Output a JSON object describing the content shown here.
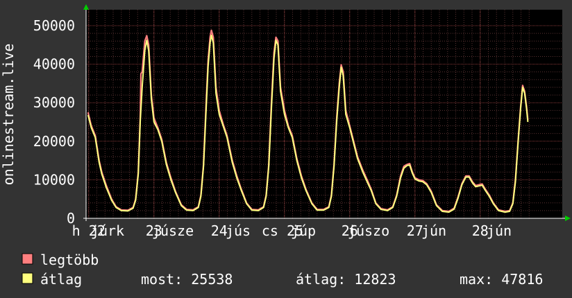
{
  "chart_data": {
    "type": "line",
    "ylabel": "onlinestream.live",
    "ylim": [
      0,
      50000
    ],
    "yticks": [
      "0",
      "10000",
      "20000",
      "30000",
      "40000",
      "50000"
    ],
    "grid": true,
    "xticks": [
      {
        "label": "h 22",
        "day": 0.0
      },
      {
        "label": "júrk",
        "day": 0.29
      },
      {
        "label": "23",
        "day": 1.0
      },
      {
        "label": "júsze",
        "day": 1.29
      },
      {
        "label": "24",
        "day": 2.0
      },
      {
        "label": "jús",
        "day": 2.29
      },
      {
        "label": "cs 25",
        "day": 2.97
      },
      {
        "label": "júp",
        "day": 3.29
      },
      {
        "label": "26",
        "day": 4.0
      },
      {
        "label": "júszo",
        "day": 4.29
      },
      {
        "label": "27",
        "day": 5.0
      },
      {
        "label": "jún",
        "day": 5.29
      },
      {
        "label": "28",
        "day": 6.0
      },
      {
        "label": "jún",
        "day": 6.29
      }
    ],
    "x_range": [
      -0.04,
      6.86
    ],
    "series": [
      {
        "name": "legtöbb",
        "color": "#ff7f7f",
        "points": [
          [
            -0.01,
            27500
          ],
          [
            0.04,
            24000
          ],
          [
            0.1,
            21500
          ],
          [
            0.16,
            15000
          ],
          [
            0.2,
            12000
          ],
          [
            0.27,
            8500
          ],
          [
            0.35,
            5000
          ],
          [
            0.42,
            3000
          ],
          [
            0.5,
            2200
          ],
          [
            0.6,
            2100
          ],
          [
            0.68,
            2800
          ],
          [
            0.72,
            5000
          ],
          [
            0.76,
            12000
          ],
          [
            0.79,
            26000
          ],
          [
            0.8,
            37500
          ],
          [
            0.82,
            38000
          ],
          [
            0.86,
            46000
          ],
          [
            0.89,
            47400
          ],
          [
            0.92,
            45000
          ],
          [
            0.96,
            32000
          ],
          [
            1.0,
            26000
          ],
          [
            1.06,
            23500
          ],
          [
            1.12,
            20500
          ],
          [
            1.19,
            14500
          ],
          [
            1.26,
            10500
          ],
          [
            1.33,
            7000
          ],
          [
            1.42,
            3500
          ],
          [
            1.5,
            2300
          ],
          [
            1.6,
            2200
          ],
          [
            1.68,
            3000
          ],
          [
            1.72,
            6000
          ],
          [
            1.76,
            14000
          ],
          [
            1.8,
            30000
          ],
          [
            1.83,
            41000
          ],
          [
            1.86,
            47000
          ],
          [
            1.88,
            48800
          ],
          [
            1.91,
            47000
          ],
          [
            1.95,
            34000
          ],
          [
            2.0,
            28000
          ],
          [
            2.06,
            24500
          ],
          [
            2.12,
            21500
          ],
          [
            2.2,
            15000
          ],
          [
            2.27,
            11000
          ],
          [
            2.34,
            7500
          ],
          [
            2.42,
            4000
          ],
          [
            2.5,
            2300
          ],
          [
            2.6,
            2200
          ],
          [
            2.68,
            3000
          ],
          [
            2.72,
            6000
          ],
          [
            2.76,
            14000
          ],
          [
            2.8,
            30000
          ],
          [
            2.84,
            43000
          ],
          [
            2.87,
            47000
          ],
          [
            2.9,
            46000
          ],
          [
            2.94,
            34000
          ],
          [
            3.0,
            28000
          ],
          [
            3.06,
            24000
          ],
          [
            3.12,
            21500
          ],
          [
            3.19,
            15500
          ],
          [
            3.26,
            11000
          ],
          [
            3.33,
            7500
          ],
          [
            3.42,
            4000
          ],
          [
            3.5,
            2300
          ],
          [
            3.6,
            2300
          ],
          [
            3.68,
            3000
          ],
          [
            3.72,
            6000
          ],
          [
            3.76,
            14000
          ],
          [
            3.8,
            26000
          ],
          [
            3.84,
            35000
          ],
          [
            3.87,
            39800
          ],
          [
            3.9,
            38000
          ],
          [
            3.94,
            28000
          ],
          [
            4.0,
            24000
          ],
          [
            4.06,
            20000
          ],
          [
            4.12,
            16000
          ],
          [
            4.2,
            12500
          ],
          [
            4.28,
            9500
          ],
          [
            4.33,
            7500
          ],
          [
            4.4,
            4000
          ],
          [
            4.48,
            2500
          ],
          [
            4.58,
            2200
          ],
          [
            4.66,
            3000
          ],
          [
            4.72,
            6000
          ],
          [
            4.78,
            11000
          ],
          [
            4.83,
            13500
          ],
          [
            4.88,
            14000
          ],
          [
            4.92,
            14200
          ],
          [
            4.96,
            12000
          ],
          [
            5.0,
            10500
          ],
          [
            5.06,
            10000
          ],
          [
            5.12,
            9800
          ],
          [
            5.18,
            9000
          ],
          [
            5.25,
            7000
          ],
          [
            5.33,
            3500
          ],
          [
            5.42,
            2000
          ],
          [
            5.52,
            1800
          ],
          [
            5.6,
            2600
          ],
          [
            5.66,
            5500
          ],
          [
            5.72,
            9000
          ],
          [
            5.78,
            11000
          ],
          [
            5.83,
            11000
          ],
          [
            5.88,
            9500
          ],
          [
            5.93,
            8500
          ],
          [
            5.98,
            8700
          ],
          [
            6.03,
            8900
          ],
          [
            6.08,
            7500
          ],
          [
            6.14,
            6000
          ],
          [
            6.2,
            4000
          ],
          [
            6.28,
            2200
          ],
          [
            6.38,
            1800
          ],
          [
            6.45,
            2000
          ],
          [
            6.5,
            4000
          ],
          [
            6.54,
            10000
          ],
          [
            6.58,
            20000
          ],
          [
            6.62,
            29000
          ],
          [
            6.65,
            34500
          ],
          [
            6.68,
            33000
          ],
          [
            6.71,
            29000
          ],
          [
            6.73,
            25500
          ]
        ]
      },
      {
        "name": "átlag",
        "color": "#ffff7f",
        "points": [
          [
            -0.01,
            26800
          ],
          [
            0.04,
            23500
          ],
          [
            0.1,
            21000
          ],
          [
            0.16,
            14500
          ],
          [
            0.2,
            11500
          ],
          [
            0.27,
            8000
          ],
          [
            0.35,
            4700
          ],
          [
            0.42,
            2800
          ],
          [
            0.5,
            2000
          ],
          [
            0.6,
            1900
          ],
          [
            0.68,
            2600
          ],
          [
            0.72,
            4700
          ],
          [
            0.76,
            11500
          ],
          [
            0.79,
            25000
          ],
          [
            0.82,
            34000
          ],
          [
            0.86,
            43500
          ],
          [
            0.89,
            46200
          ],
          [
            0.92,
            43500
          ],
          [
            0.96,
            31000
          ],
          [
            1.0,
            25000
          ],
          [
            1.06,
            23000
          ],
          [
            1.12,
            20000
          ],
          [
            1.19,
            14000
          ],
          [
            1.26,
            10000
          ],
          [
            1.33,
            6700
          ],
          [
            1.42,
            3300
          ],
          [
            1.5,
            2100
          ],
          [
            1.6,
            2000
          ],
          [
            1.68,
            2800
          ],
          [
            1.72,
            5700
          ],
          [
            1.76,
            13500
          ],
          [
            1.8,
            28500
          ],
          [
            1.83,
            39500
          ],
          [
            1.86,
            45500
          ],
          [
            1.88,
            47500
          ],
          [
            1.91,
            45500
          ],
          [
            1.95,
            32500
          ],
          [
            2.0,
            27000
          ],
          [
            2.06,
            24000
          ],
          [
            2.12,
            21000
          ],
          [
            2.2,
            14500
          ],
          [
            2.27,
            10500
          ],
          [
            2.34,
            7200
          ],
          [
            2.42,
            3800
          ],
          [
            2.5,
            2100
          ],
          [
            2.6,
            2000
          ],
          [
            2.68,
            2800
          ],
          [
            2.72,
            5700
          ],
          [
            2.76,
            13500
          ],
          [
            2.8,
            28500
          ],
          [
            2.84,
            41500
          ],
          [
            2.87,
            46200
          ],
          [
            2.9,
            45000
          ],
          [
            2.94,
            33000
          ],
          [
            3.0,
            27000
          ],
          [
            3.06,
            23500
          ],
          [
            3.12,
            21000
          ],
          [
            3.19,
            15000
          ],
          [
            3.26,
            10500
          ],
          [
            3.33,
            7200
          ],
          [
            3.42,
            3800
          ],
          [
            3.5,
            2100
          ],
          [
            3.6,
            2100
          ],
          [
            3.68,
            2800
          ],
          [
            3.72,
            5700
          ],
          [
            3.76,
            13500
          ],
          [
            3.8,
            25000
          ],
          [
            3.84,
            34000
          ],
          [
            3.87,
            39200
          ],
          [
            3.9,
            37000
          ],
          [
            3.94,
            27000
          ],
          [
            4.0,
            23500
          ],
          [
            4.06,
            19500
          ],
          [
            4.12,
            15500
          ],
          [
            4.2,
            12000
          ],
          [
            4.28,
            9000
          ],
          [
            4.33,
            7200
          ],
          [
            4.4,
            3800
          ],
          [
            4.48,
            2300
          ],
          [
            4.58,
            2000
          ],
          [
            4.66,
            2800
          ],
          [
            4.72,
            5700
          ],
          [
            4.78,
            10500
          ],
          [
            4.83,
            13000
          ],
          [
            4.88,
            13700
          ],
          [
            4.92,
            13800
          ],
          [
            4.96,
            11700
          ],
          [
            5.0,
            10200
          ],
          [
            5.06,
            9700
          ],
          [
            5.12,
            9500
          ],
          [
            5.18,
            8700
          ],
          [
            5.25,
            6700
          ],
          [
            5.33,
            3300
          ],
          [
            5.42,
            1800
          ],
          [
            5.52,
            1600
          ],
          [
            5.6,
            2400
          ],
          [
            5.66,
            5200
          ],
          [
            5.72,
            8700
          ],
          [
            5.78,
            10700
          ],
          [
            5.83,
            10700
          ],
          [
            5.88,
            9200
          ],
          [
            5.93,
            8200
          ],
          [
            5.98,
            8400
          ],
          [
            6.03,
            8600
          ],
          [
            6.08,
            7200
          ],
          [
            6.14,
            5700
          ],
          [
            6.2,
            3800
          ],
          [
            6.28,
            2000
          ],
          [
            6.38,
            1600
          ],
          [
            6.45,
            1800
          ],
          [
            6.5,
            3800
          ],
          [
            6.54,
            9500
          ],
          [
            6.58,
            19500
          ],
          [
            6.62,
            28500
          ],
          [
            6.65,
            34000
          ],
          [
            6.68,
            32500
          ],
          [
            6.71,
            28500
          ],
          [
            6.73,
            25000
          ]
        ]
      }
    ],
    "legend": [
      {
        "label": "legtöbb",
        "color": "#ff7f7f"
      },
      {
        "label": "átlag",
        "color": "#ffff7f"
      }
    ],
    "stats": {
      "now": "most: 25538",
      "avg": "átlag: 12823",
      "max": "max: 47816"
    }
  }
}
